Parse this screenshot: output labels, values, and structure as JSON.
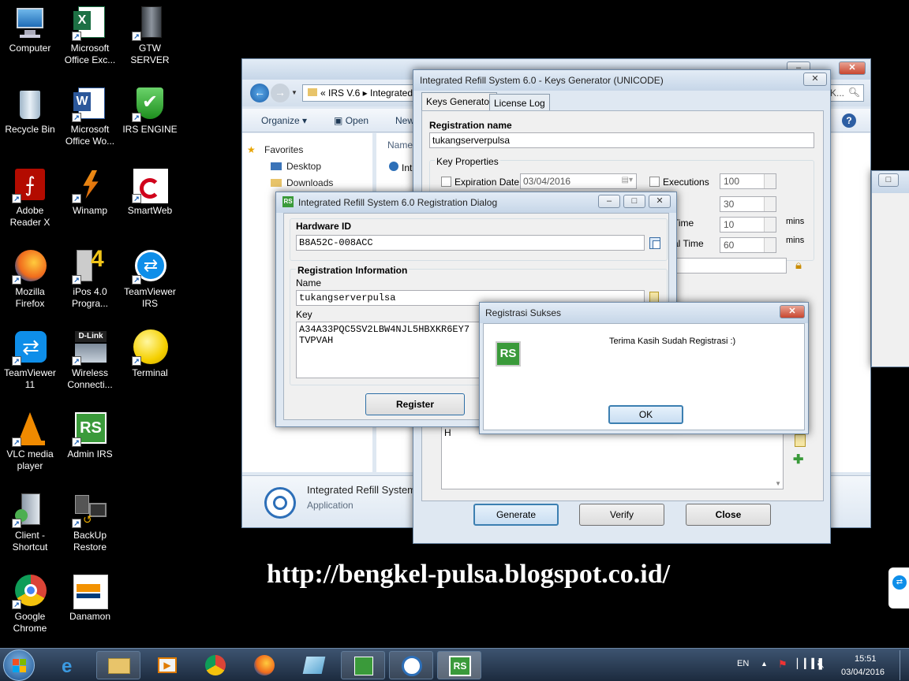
{
  "desktop": {
    "icons": [
      {
        "label": "Computer"
      },
      {
        "label": "Microsoft Office Exc..."
      },
      {
        "label": "GTW SERVER"
      },
      {
        "label": "Recycle Bin"
      },
      {
        "label": "Microsoft Office Wo..."
      },
      {
        "label": "IRS ENGINE"
      },
      {
        "label": "Adobe Reader X"
      },
      {
        "label": "Winamp"
      },
      {
        "label": "SmartWeb"
      },
      {
        "label": "Mozilla Firefox"
      },
      {
        "label": "iPos 4.0 Progra..."
      },
      {
        "label": "TeamViewer IRS"
      },
      {
        "label": "TeamViewer 11"
      },
      {
        "label": "Wireless Connecti..."
      },
      {
        "label": "Terminal"
      },
      {
        "label": "VLC media player"
      },
      {
        "label": "Admin IRS"
      },
      {
        "label": "Client - Shortcut"
      },
      {
        "label": "BackUp Restore"
      },
      {
        "label": "Google Chrome"
      },
      {
        "label": "Danamon"
      }
    ],
    "watermark": "http://bengkel-pulsa.blogspot.co.id/"
  },
  "explorer": {
    "breadcrumb": [
      "«",
      "IRS V.6",
      "Integrated"
    ],
    "search_placeholder": "K...",
    "toolbar": {
      "organize": "Organize",
      "open": "Open",
      "new": "New"
    },
    "nav": {
      "favorites": "Favorites",
      "desktop": "Desktop",
      "downloads": "Downloads"
    },
    "column_header": "Name",
    "file_stub": "Int",
    "details": {
      "name": "Integrated Refill System",
      "type": "Application"
    }
  },
  "keygen": {
    "title": "Integrated Refill System 6.0 - Keys Generator (UNICODE)",
    "tabs": [
      "Keys Generator",
      "License Log"
    ],
    "registration_name_label": "Registration name",
    "registration_name": "tukangserverpulsa",
    "key_properties_label": "Key Properties",
    "expiration_label": "Expiration Date",
    "expiration_date": "03/04/2016",
    "executions_label": "Executions",
    "executions": "100",
    "field2": "30",
    "time_label_1": "Time",
    "time_value_1": "10",
    "mins_1": "mins",
    "time_label_2": "al Time",
    "time_value_2": "60",
    "mins_2": "mins",
    "key_text_fragment": "H",
    "generate": "Generate",
    "verify": "Verify",
    "close": "Close"
  },
  "regdialog": {
    "title": "Integrated Refill System 6.0 Registration Dialog",
    "hardware_label": "Hardware ID",
    "hardware_id": "B8A52C-008ACC",
    "reg_info_label": "Registration Information",
    "name_label": "Name",
    "name": "tukangserverpulsa",
    "key_label": "Key",
    "key_line1": "A34A33PQC5SV2LBW4NJL5HBXKR6EY7",
    "key_line2": "TVPVAH",
    "register": "Register"
  },
  "message": {
    "title": "Registrasi Sukses",
    "text": "Terima Kasih Sudah Registrasi :)",
    "ok": "OK"
  },
  "taskbar": {
    "lang": "EN",
    "time": "15:51",
    "date": "03/04/2016"
  },
  "colors": {
    "accent": "#3c7fb1",
    "irs_green": "#3a9a3a",
    "irs_red": "#d23a2a"
  }
}
